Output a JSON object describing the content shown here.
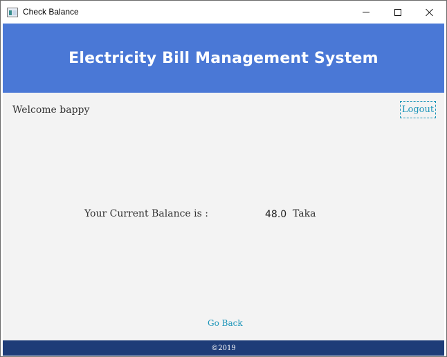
{
  "window": {
    "title": "Check Balance",
    "icon": "app-window-icon"
  },
  "header": {
    "title": "Electricity Bill Management System",
    "color": "#4a78d6"
  },
  "user": {
    "welcome": "Welcome  bappy",
    "logout_label": "Logout"
  },
  "balance": {
    "label": "Your Current Balance is :",
    "value": "48.0",
    "unit": "Taka"
  },
  "nav": {
    "go_back_label": "Go Back"
  },
  "footer": {
    "text": "©2019",
    "color": "#1e3c78"
  },
  "colors": {
    "link": "#1a94b8",
    "content_bg": "#f3f3f3"
  }
}
